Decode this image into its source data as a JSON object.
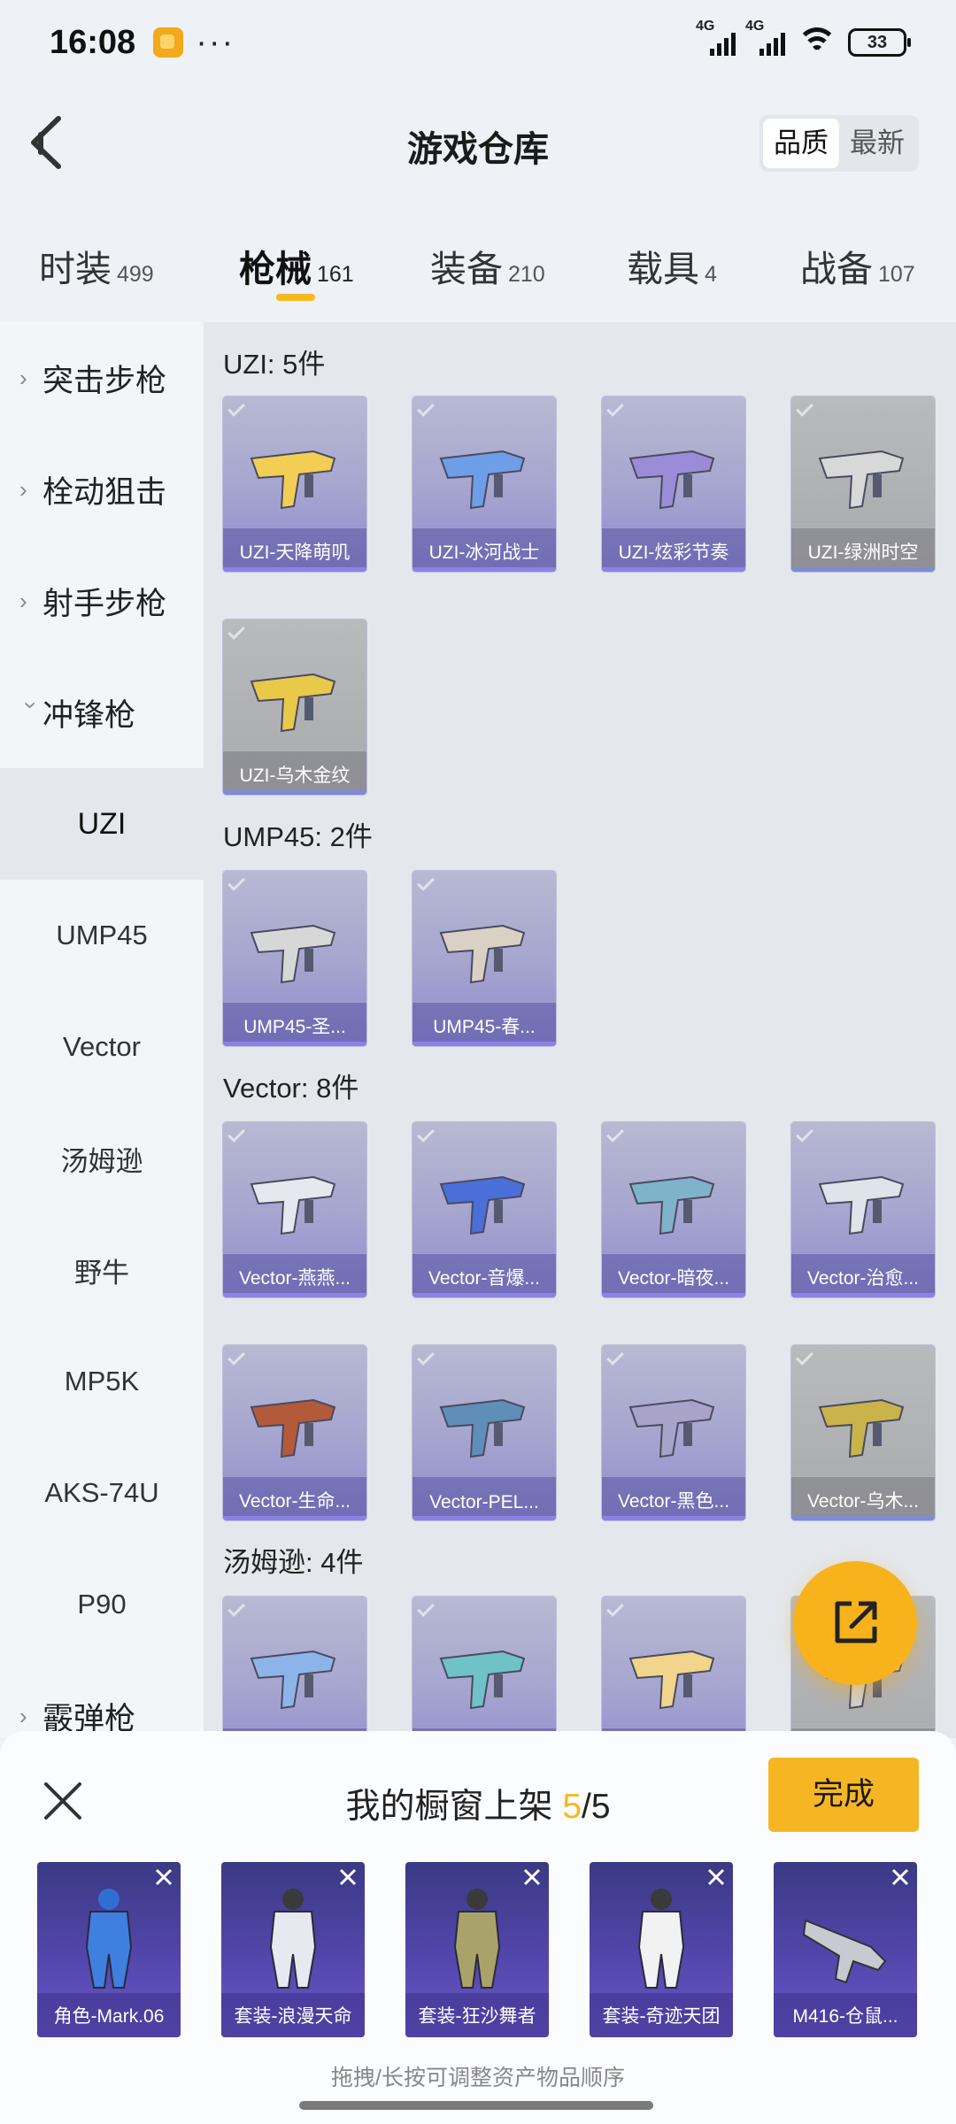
{
  "status_bar": {
    "time": "16:08",
    "dots": "···",
    "network_1": "4G",
    "network_2": "4G",
    "battery": "33"
  },
  "header": {
    "title": "游戏仓库",
    "sort_options": [
      "品质",
      "最新"
    ],
    "sort_selected": "品质"
  },
  "tabs": [
    {
      "label": "时装",
      "count": "499"
    },
    {
      "label": "枪械",
      "count": "161",
      "active": true
    },
    {
      "label": "装备",
      "count": "210"
    },
    {
      "label": "载具",
      "count": "4"
    },
    {
      "label": "战备",
      "count": "107"
    }
  ],
  "sidebar": {
    "groups": [
      {
        "label": "突击步枪",
        "expanded": false
      },
      {
        "label": "栓动狙击",
        "expanded": false
      },
      {
        "label": "射手步枪",
        "expanded": false
      },
      {
        "label": "冲锋枪",
        "expanded": true
      },
      {
        "label": "霰弹枪",
        "expanded": false
      }
    ],
    "sub_items": [
      "UZI",
      "UMP45",
      "Vector",
      "汤姆逊",
      "野牛",
      "MP5K",
      "AKS-74U",
      "P90"
    ],
    "selected": "UZI"
  },
  "sections": [
    {
      "title": "UZI: 5件",
      "items": [
        "UZI-天降萌叽",
        "UZI-冰河战士",
        "UZI-炫彩节奏",
        "UZI-绿洲时空",
        "UZI-乌木金纹"
      ]
    },
    {
      "title": "UMP45: 2件",
      "items": [
        "UMP45-圣...",
        "UMP45-春..."
      ]
    },
    {
      "title": "Vector: 8件",
      "items": [
        "Vector-燕燕...",
        "Vector-音爆...",
        "Vector-暗夜...",
        "Vector-治愈...",
        "Vector-生命...",
        "Vector-PEL...",
        "Vector-黑色...",
        "Vector-乌木..."
      ]
    },
    {
      "title": "汤姆逊: 4件",
      "items": [
        "",
        "",
        "",
        ""
      ]
    }
  ],
  "showcase": {
    "title_prefix": "我的橱窗上架",
    "current": "5",
    "total": "/5",
    "done_label": "完成",
    "items": [
      "角色-Mark.06",
      "套装-浪漫天命",
      "套装-狂沙舞者",
      "套装-奇迹天团",
      "M416-仓鼠..."
    ],
    "hint": "拖拽/长按可调整资产物品顺序"
  },
  "colors": {
    "accent": "#f5b820",
    "card_purple": "#9a96d2",
    "card_grey": "#aeafb2",
    "showcase_card": "#4a3f9e"
  }
}
